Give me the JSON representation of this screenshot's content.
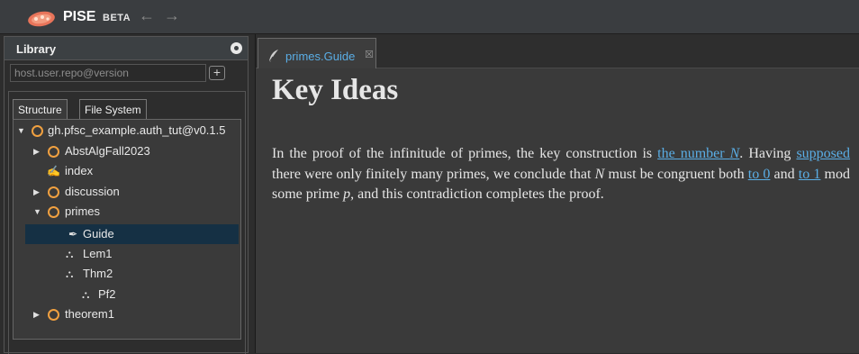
{
  "app": {
    "name": "PISE",
    "badge": "BETA",
    "back_arrow": "←",
    "forward_arrow": "→"
  },
  "colors": {
    "accent": "#5aaee6",
    "node_circle": "#f0a040",
    "selected_row": "#153044"
  },
  "sidebar": {
    "title": "Library",
    "repo_input_placeholder": "host.user.repo@version",
    "add_label": "+",
    "tabs": [
      {
        "label": "Structure",
        "active": true
      },
      {
        "label": "File System",
        "active": false
      }
    ],
    "tree": [
      {
        "label": "gh.pfsc_example.auth_tut@v0.1.5",
        "kind": "repo",
        "expanded": true
      },
      {
        "label": "AbstAlgFall2023",
        "kind": "module",
        "expanded": false
      },
      {
        "label": "index",
        "kind": "annotation"
      },
      {
        "label": "discussion",
        "kind": "module",
        "expanded": false
      },
      {
        "label": "primes",
        "kind": "module",
        "expanded": true
      },
      {
        "label": "Guide",
        "kind": "annotation",
        "selected": true
      },
      {
        "label": "Lem1",
        "kind": "deduction"
      },
      {
        "label": "Thm2",
        "kind": "deduction"
      },
      {
        "label": "Pf2",
        "kind": "deduction"
      },
      {
        "label": "theorem1",
        "kind": "module",
        "expanded": false
      }
    ]
  },
  "editor": {
    "tab": {
      "label": "primes.Guide",
      "close": "☒"
    },
    "heading": "Key Ideas",
    "paragraph": {
      "t1": "In the proof of the infinitude of primes, the key construction is ",
      "link1": "the number ",
      "link1_math": "N",
      "t2": ". Having ",
      "link2": "supposed",
      "t3": " there were only finitely many primes, we conclude that ",
      "math1": "N",
      "t4": " must be congruent both ",
      "link3": "to 0",
      "t5": " and ",
      "link4": "to 1",
      "t6": " mod some prime ",
      "math2": "p",
      "t7": ", and this contradiction completes the proof."
    }
  }
}
